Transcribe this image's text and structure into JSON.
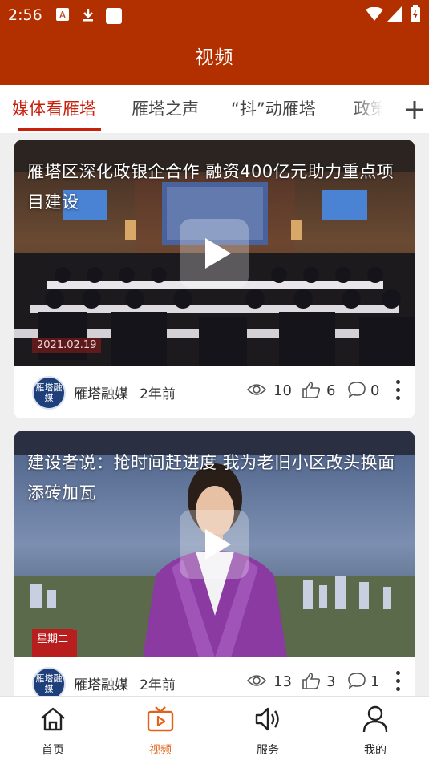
{
  "status_bar": {
    "time": "2:56",
    "icons": [
      "a-icon",
      "download-icon",
      "app-square-icon",
      "wifi-icon",
      "signal-icon",
      "battery-icon"
    ]
  },
  "app_bar": {
    "title": "视频"
  },
  "tabs": {
    "items": [
      {
        "label": "媒体看雁塔",
        "active": true
      },
      {
        "label": "雁塔之声",
        "active": false
      },
      {
        "label": "“抖”动雁塔",
        "active": false
      },
      {
        "label": "政策",
        "active": false
      }
    ],
    "add_icon": "plus-icon"
  },
  "videos": [
    {
      "title": "雁塔区深化政银企合作  融资400亿元助力重点项目建设",
      "thumb_date": "2021.02.19",
      "author": "雁塔融媒",
      "avatar_text": "雁塔融媒",
      "age": "2年前",
      "views": "10",
      "likes": "6",
      "comments": "0"
    },
    {
      "title": "建设者说：抢时间赶进度  我为老旧小区改头换面添砖加瓦",
      "thumb_date": "星期二",
      "author": "雁塔融媒",
      "avatar_text": "雁塔融媒",
      "age": "2年前",
      "views": "13",
      "likes": "3",
      "comments": "1"
    }
  ],
  "bottom_nav": [
    {
      "label": "首页",
      "icon": "home-icon",
      "active": false
    },
    {
      "label": "视频",
      "icon": "video-tv-icon",
      "active": true
    },
    {
      "label": "服务",
      "icon": "speaker-icon",
      "active": false
    },
    {
      "label": "我的",
      "icon": "user-icon",
      "active": false
    }
  ],
  "colors": {
    "brand": "#b23000",
    "active_tab": "#c9200c",
    "active_nav": "#e0631c"
  }
}
